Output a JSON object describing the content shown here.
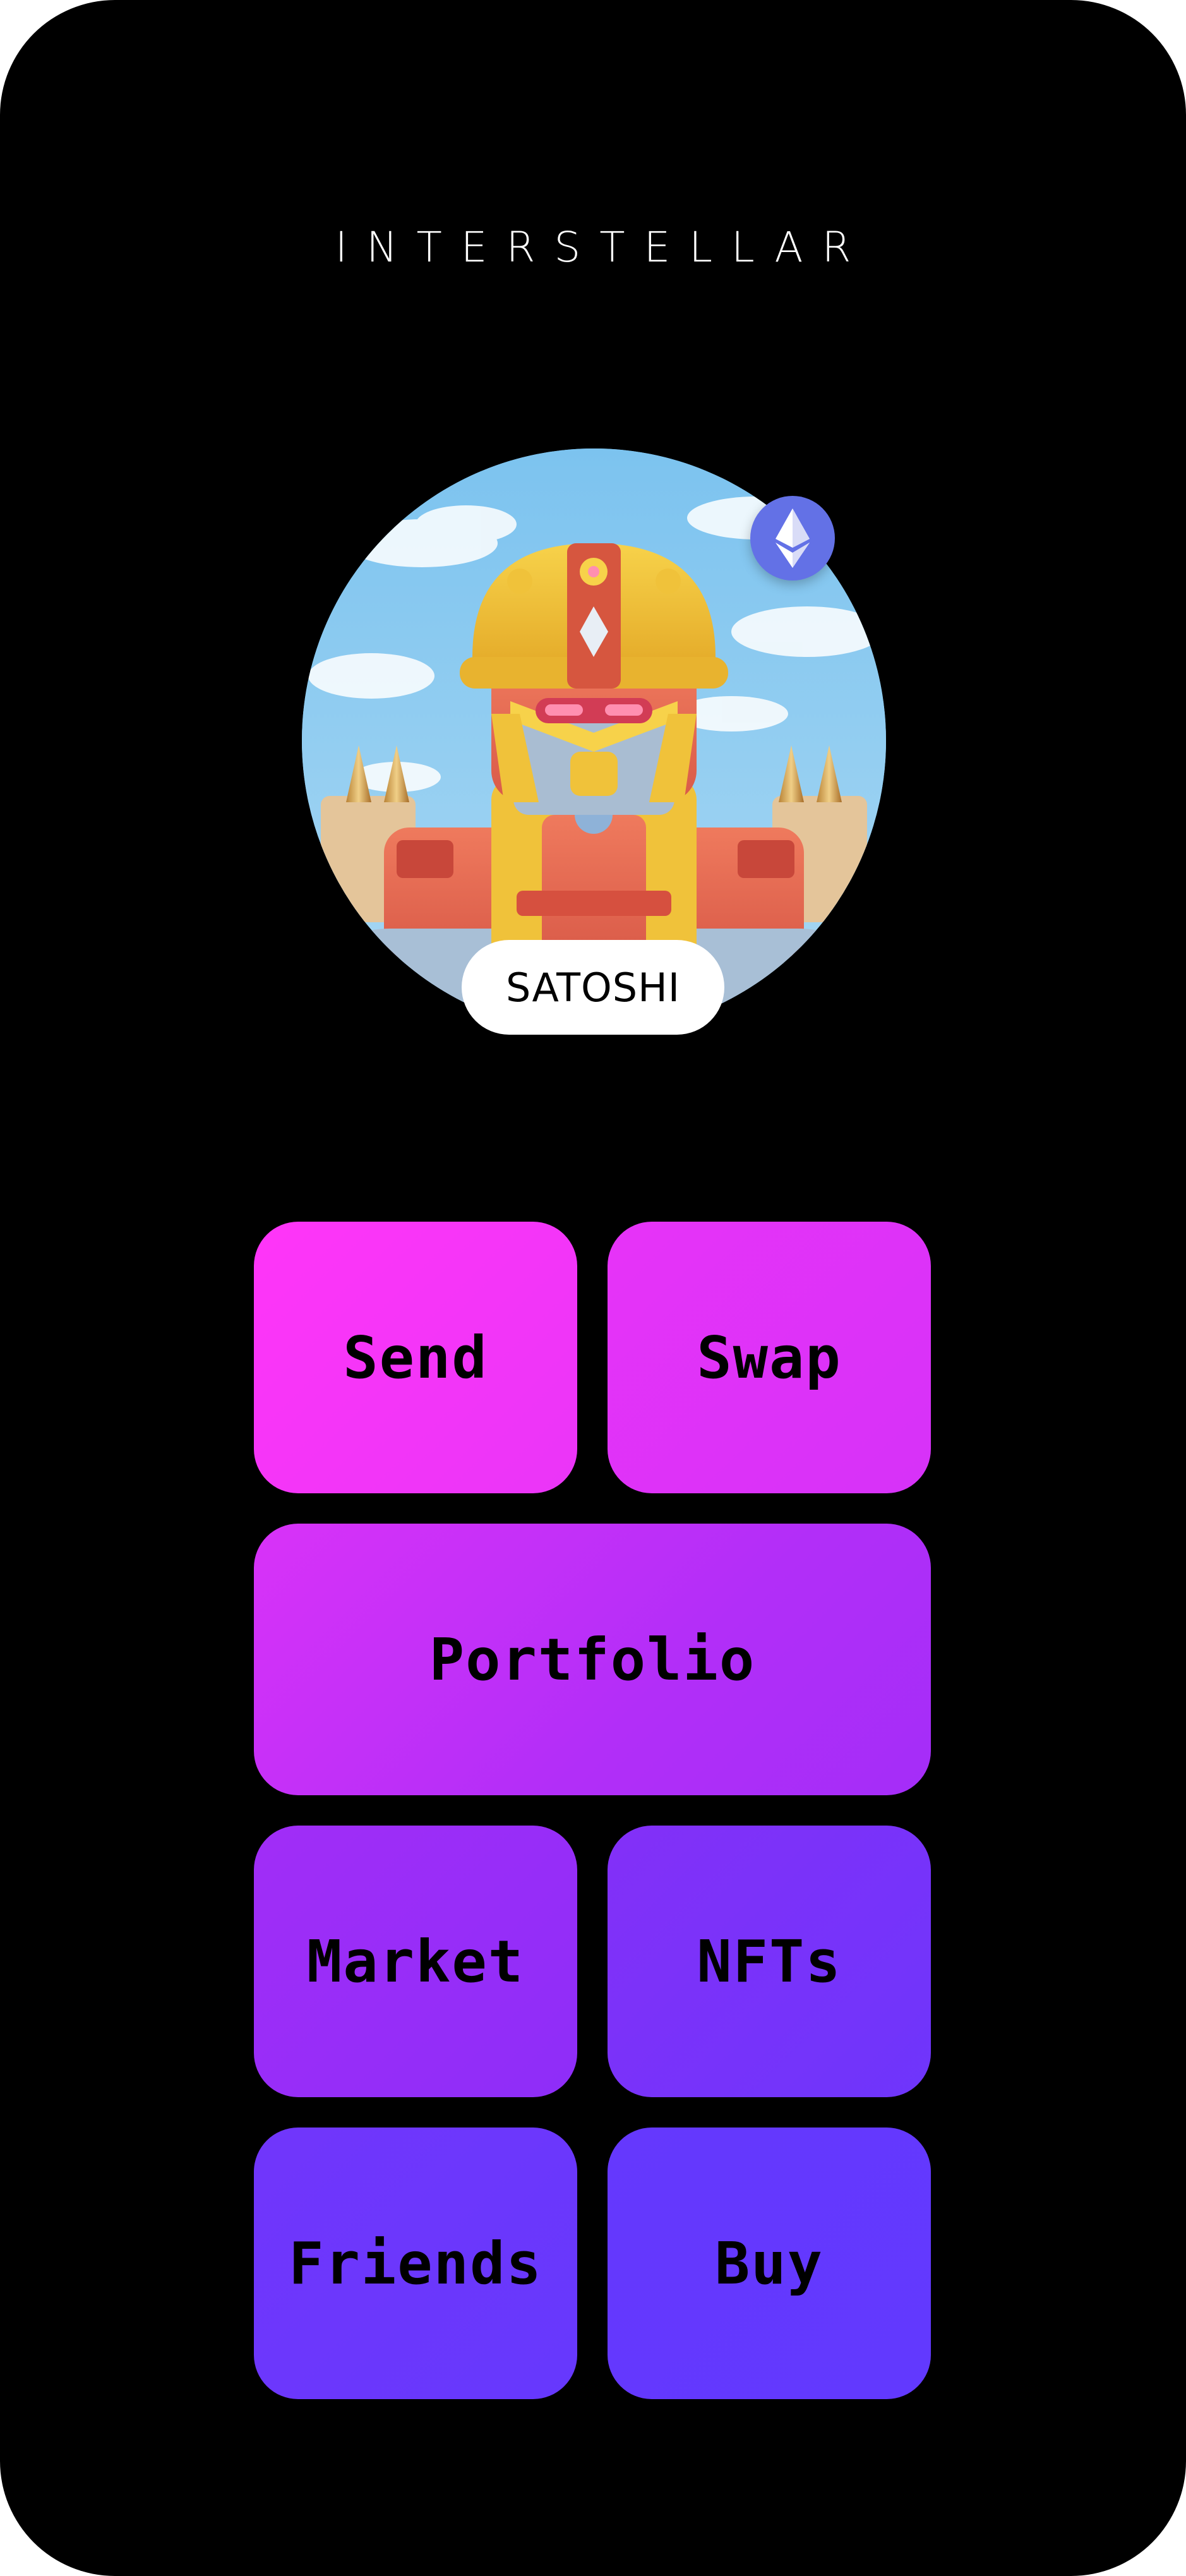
{
  "app": {
    "brand": "INTERSTELLAR"
  },
  "profile": {
    "username": "SATOSHI",
    "network_badge_icon": "ethereum-icon",
    "avatar_icon": "robot-avatar"
  },
  "menu": {
    "items": [
      {
        "label": "Send"
      },
      {
        "label": "Swap"
      },
      {
        "label": "Portfolio"
      },
      {
        "label": "Market"
      },
      {
        "label": "NFTs"
      },
      {
        "label": "Friends"
      },
      {
        "label": "Buy"
      }
    ]
  },
  "colors": {
    "background": "#000000",
    "gradient_start": "#ff35f8",
    "gradient_end": "#6239fe",
    "badge": "#6371e6",
    "pill": "#ffffff"
  }
}
